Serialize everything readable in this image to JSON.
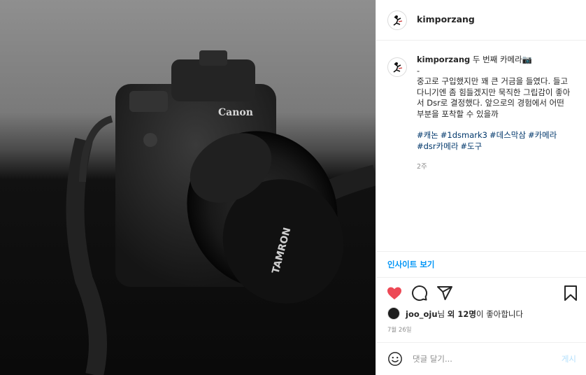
{
  "post": {
    "username": "kimporzang",
    "caption_title": "두 번째 카메라📷",
    "caption_dash": "-",
    "caption_body": "중고로 구입했지만 꽤 큰 거금을 들였다. 들고다니기엔 좀 힘들겠지만 묵직한 그립감이 좋아서 Dsr로 결정했다. 앞으로의 경험에서 어떤 부분을 포착할 수 있을까",
    "hashtags": [
      "#캐논",
      "#1dsmark3",
      "#데스막삼",
      "#카메라",
      "#dsr카메라",
      "#도구"
    ],
    "time_ago": "2주"
  },
  "photo": {
    "brand_text": "Canon",
    "lens_text": "TAMRON"
  },
  "insight_label": "인사이트 보기",
  "actions": {
    "like_icon": "heart-filled-icon",
    "comment_icon": "speech-bubble-icon",
    "share_icon": "paper-plane-icon",
    "save_icon": "bookmark-icon",
    "like_color": "#ed4956"
  },
  "likes": {
    "liker": "joo_oju",
    "suffix1": "님 ",
    "others_bold": "외 12명",
    "suffix2": "이 좋아합니다"
  },
  "post_date": "7월 26일",
  "comment": {
    "emoji_icon": "smiley-icon",
    "placeholder": "댓글 달기...",
    "post_label": "게시"
  }
}
